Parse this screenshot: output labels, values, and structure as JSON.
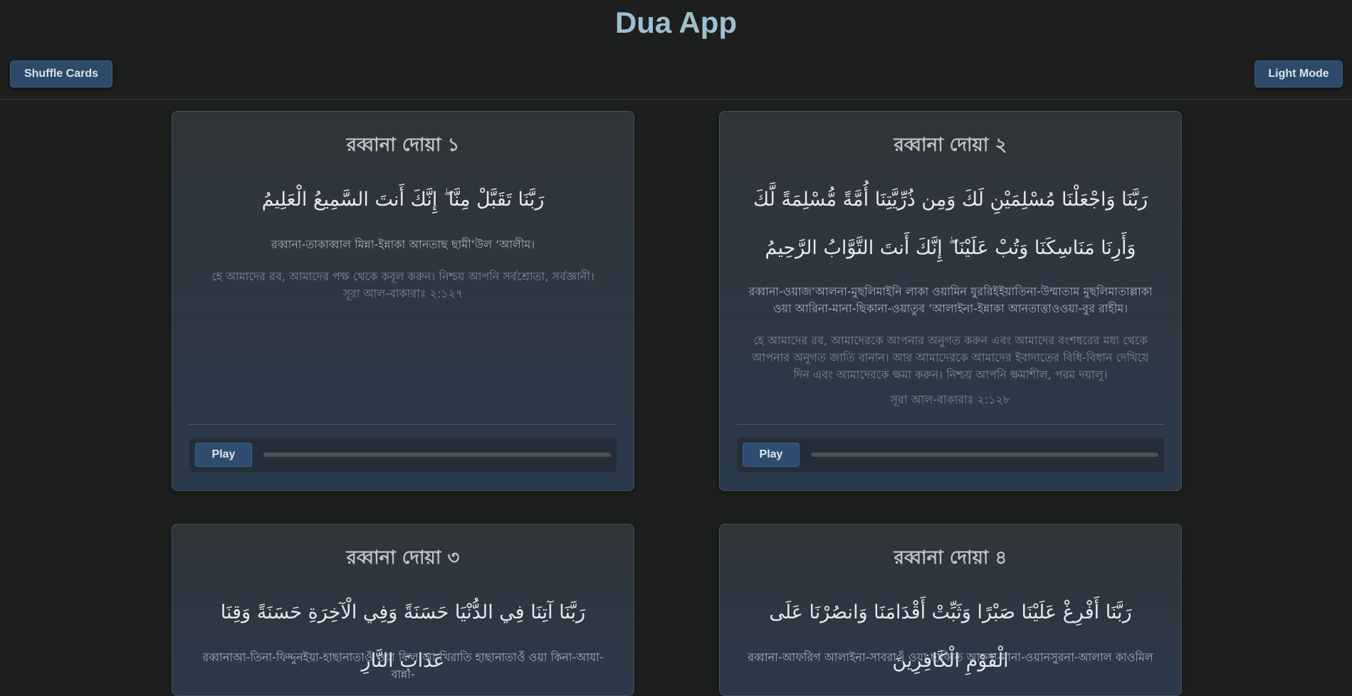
{
  "app": {
    "title": "Dua App",
    "shuffle_label": "Shuffle Cards",
    "theme_label": "Light Mode"
  },
  "cards": [
    {
      "title": "রব্বানা দোয়া ১",
      "arabic": "رَبَّنَا تَقَبَّلْ مِنَّا ۖ إِنَّكَ أَنتَ السَّمِيعُ الْعَلِيمُ",
      "transliteration": "রব্বানা-তাকাব্বাল মিন্না-ইন্নাকা আনতাছ ছামী‘উল ‘আলীম।",
      "meaning": "হে আমাদের রব, আমাদের পক্ষ থেকে কবূল করুন। নিশ্চয় আপনি সর্বশ্রোতা, সর্বজ্ঞানী।",
      "reference": "সূরা আল-বাকারাঃ ২:১২৭",
      "play_label": "Play",
      "progress": 0
    },
    {
      "title": "রব্বানা দোয়া ২",
      "arabic": "رَبَّنَا وَاجْعَلْنَا مُسْلِمَيْنِ لَكَ وَمِن ذُرِّيَّتِنَا أُمَّةً مُّسْلِمَةً لَّكَ وَأَرِنَا مَنَاسِكَنَا وَتُبْ عَلَيْنَا ۖ إِنَّكَ أَنتَ التَّوَّابُ الرَّحِيمُ",
      "transliteration": "রব্বানা-ওয়াজ‘আলনা-মুছলিমাইনি লাকা ওয়ামিন যুররিইইয়াতিনা-উম্মাতাম মুছলিমাতাল্লাকা ওয়া আরিনা-মানা-ছিকানা-ওয়াতুব ‘আলাইনা-ইন্নাকা আনতাত্তাওওয়া-বুর রাহীম।",
      "meaning": "হে আমাদের রব, আমাদেরকে আপনার অনুগত করুন এবং আমাদের বংশধরের মধ্য থেকে আপনার অনুগত জাতি বানান। আর আমাদেরকে আমাদের ইবাদাতের বিধি-বিধান দেখিয়ে দিন এবং আমাদেরকে ক্ষমা করুন। নিশ্চয় আপনি ক্ষমাশীল, পরম দয়ালু।",
      "reference": "সূরা আল-বাকারাঃ ২:১২৮",
      "play_label": "Play",
      "progress": 0
    },
    {
      "title": "রব্বানা দোয়া ৩",
      "arabic": "رَبَّنَا آتِنَا فِي الدُّنْيَا حَسَنَةً وَفِي الْآخِرَةِ حَسَنَةً وَقِنَا عَذَابَ النَّارِ",
      "transliteration": "রব্বানাআ-তিনা-ফিদ্দুনইয়া-হাছানাতাওঁ ওয়া ফিল আ-খিরাতি হাছানাতাওঁ ওয়া কিনা-আযা-বান্না-"
    },
    {
      "title": "রব্বানা দোয়া ৪",
      "arabic": "رَبَّنَا أَفْرِغْ عَلَيْنَا صَبْرًا وَثَبِّتْ أَقْدَامَنَا وَانصُرْنَا عَلَى الْقَوْمِ الْكَافِرِينَ",
      "transliteration": "রব্বানা-আফরিগ আলাইনা-সাবরাওঁ ওয়া ছাব্বিত আকদা-মানা-ওয়ানসুরনা-আলাল কাওমিল"
    }
  ]
}
